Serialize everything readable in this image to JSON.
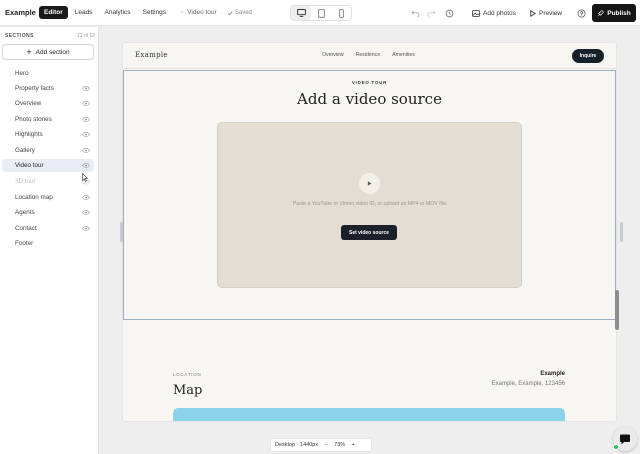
{
  "app": {
    "brand": "Example",
    "tabs": [
      "Editor",
      "Leads",
      "Analytics",
      "Settings"
    ],
    "active_tab": "Editor",
    "breadcrumb": "Video tour",
    "saved_label": "Saved",
    "add_photos": "Add photos",
    "preview": "Preview",
    "publish": "Publish"
  },
  "sidebar": {
    "title": "SECTIONS",
    "count": "11 of 12",
    "add_section": "Add section",
    "items": [
      {
        "label": "Hero",
        "visible": null
      },
      {
        "label": "Property facts",
        "visible": true
      },
      {
        "label": "Overview",
        "visible": true
      },
      {
        "label": "Photo stories",
        "visible": true
      },
      {
        "label": "Highlights",
        "visible": true
      },
      {
        "label": "Gallery",
        "visible": true
      },
      {
        "label": "Video tour",
        "visible": true,
        "active": true
      },
      {
        "label": "3D tour",
        "visible": false
      },
      {
        "label": "Location map",
        "visible": true
      },
      {
        "label": "Agents",
        "visible": true
      },
      {
        "label": "Contact",
        "visible": true
      },
      {
        "label": "Footer",
        "visible": null
      }
    ]
  },
  "site": {
    "logo": "Example",
    "nav": [
      "Overview",
      "Residence",
      "Amenities"
    ],
    "inquire": "Inquire"
  },
  "video_section": {
    "label": "VIDEO TOUR",
    "heading": "Add a video source",
    "hint": "Paste a YouTube or Vimeo video ID, or upload an MP4 or MOV file.",
    "button": "Set video source"
  },
  "map_section": {
    "label": "LOCATION",
    "heading": "Map",
    "name": "Example",
    "address": "Example, Example, 123456"
  },
  "zoom": {
    "device": "Desktop · 1440px",
    "minus": "−",
    "level": "73%",
    "plus": "+"
  },
  "colors": {
    "accent_dark": "#161616",
    "canvas_bg": "#f8f6f2",
    "video_box": "#e4ddd4",
    "map_fill": "#8ad3ea",
    "selection": "#9aaec6"
  }
}
